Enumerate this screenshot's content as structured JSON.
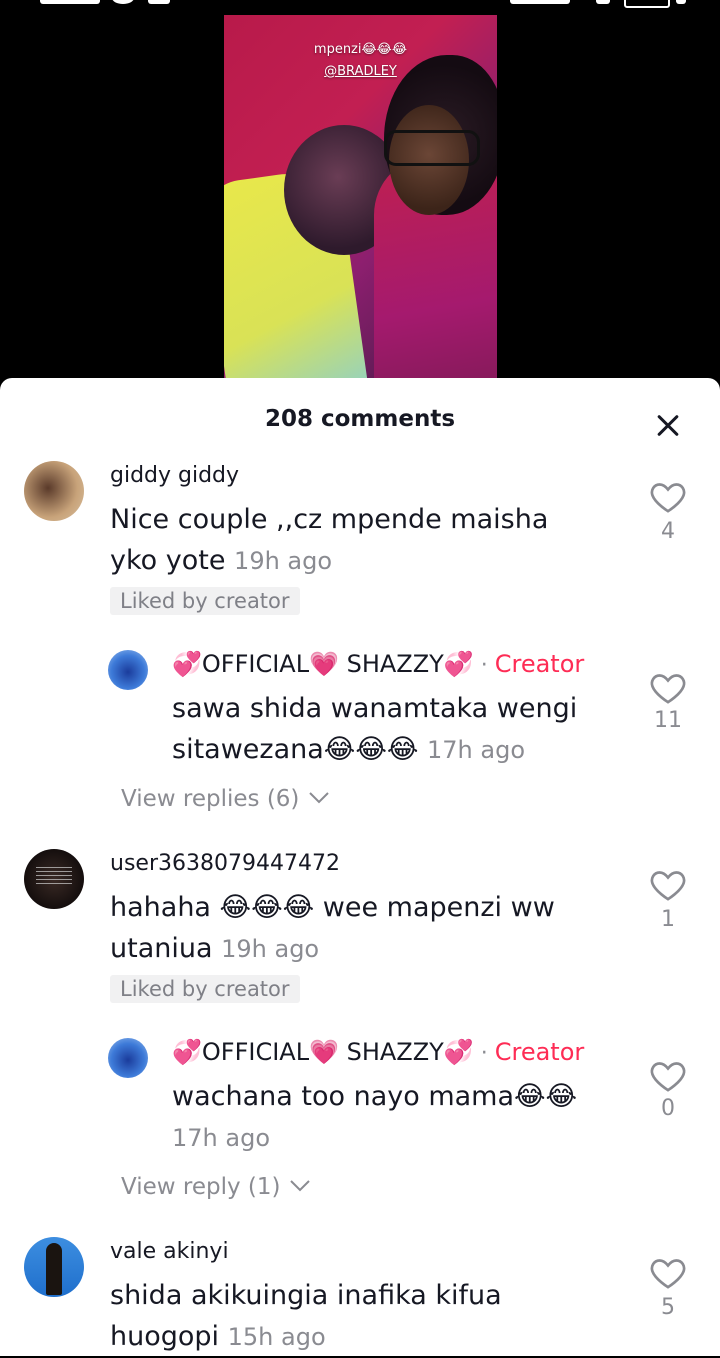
{
  "video": {
    "caption_line1": "mpenzi😂😂😂",
    "caption_line2": "@BRADLEY"
  },
  "sheet": {
    "title": "208 comments"
  },
  "comments": [
    {
      "username": "giddy giddy",
      "text": "Nice couple ,,cz mpende maisha yko yote",
      "time": "19h ago",
      "badge": "Liked by creator",
      "likes": "4",
      "replies_label": "",
      "reply": {
        "username": "💞OFFICIAL💗 SHAZZY💞",
        "separator": "·",
        "creator_label": "Creator",
        "text": "sawa shida wanamtaka wengi sitawezana😂😂😂",
        "time": "17h ago",
        "likes": "11",
        "view_label": "View replies (6)"
      }
    },
    {
      "username": "user3638079447472",
      "text": "hahaha 😂😂😂 wee mapenzi ww utaniua",
      "time": "19h ago",
      "badge": "Liked by creator",
      "likes": "1",
      "reply": {
        "username": "💞OFFICIAL💗 SHAZZY💞",
        "separator": "·",
        "creator_label": "Creator",
        "text": "wachana too nayo mama😂😂",
        "time": "17h ago",
        "likes": "0",
        "view_label": "View reply (1)"
      }
    },
    {
      "username": "vale akinyi",
      "text": "shida akikuingia inafika kifua huogopi",
      "time": "15h ago",
      "likes": "5"
    }
  ],
  "icons": [
    "close-icon",
    "heart-icon",
    "chevron-down-icon",
    "avatar"
  ],
  "colors": {
    "creator_accent": "#fe2c55",
    "muted_text": "#8a8b91",
    "primary_text": "#161823"
  }
}
